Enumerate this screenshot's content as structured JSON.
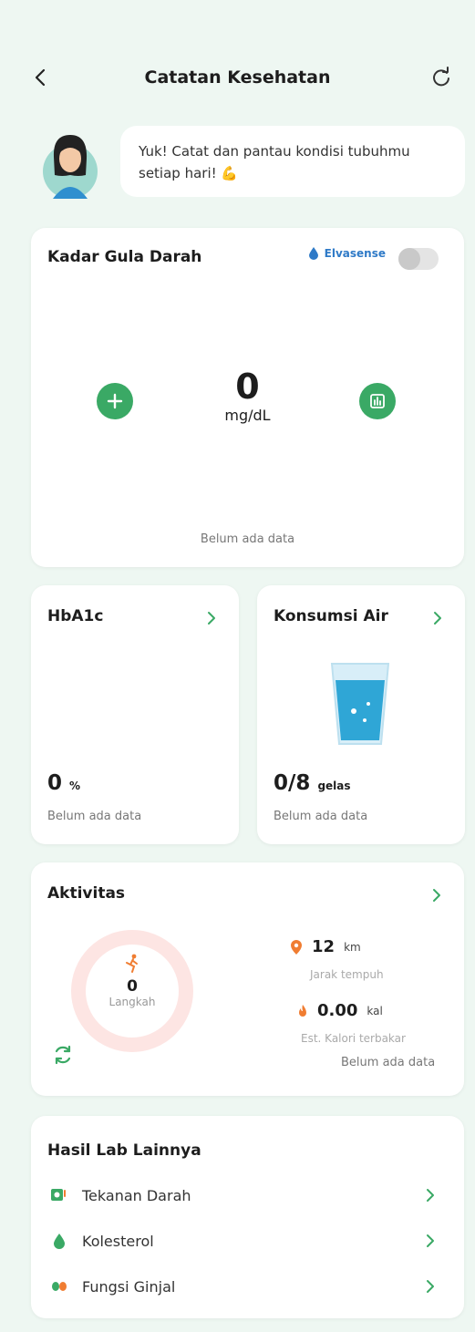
{
  "header": {
    "title": "Catatan Kesehatan"
  },
  "greeting": {
    "message": "Yuk! Catat dan pantau kondisi tubuhmu setiap hari! 💪"
  },
  "glucose": {
    "title": "Kadar Gula Darah",
    "brand": "Elvasense",
    "value": "0",
    "unit": "mg/dL",
    "status": "Belum ada data"
  },
  "hba1c": {
    "title": "HbA1c",
    "value": "0",
    "unit": "%",
    "status": "Belum ada data"
  },
  "water": {
    "title": "Konsumsi Air",
    "value": "0/8",
    "unit": "gelas",
    "status": "Belum ada data"
  },
  "activity": {
    "title": "Aktivitas",
    "steps_value": "0",
    "steps_label": "Langkah",
    "distance_value": "12",
    "distance_unit": "km",
    "distance_label": "Jarak tempuh",
    "calorie_value": "0.00",
    "calorie_unit": "kal",
    "calorie_label": "Est. Kalori terbakar",
    "status": "Belum ada data"
  },
  "lab": {
    "title": "Hasil Lab Lainnya",
    "items": [
      {
        "label": "Tekanan Darah",
        "icon": "blood-pressure-icon"
      },
      {
        "label": "Kolesterol",
        "icon": "drop-icon"
      },
      {
        "label": "Fungsi Ginjal",
        "icon": "kidney-icon"
      }
    ]
  },
  "colors": {
    "accent": "#3aa965",
    "background": "#eef7f2",
    "activity_ring": "#fde5e3",
    "icon_orange": "#f07d32"
  }
}
